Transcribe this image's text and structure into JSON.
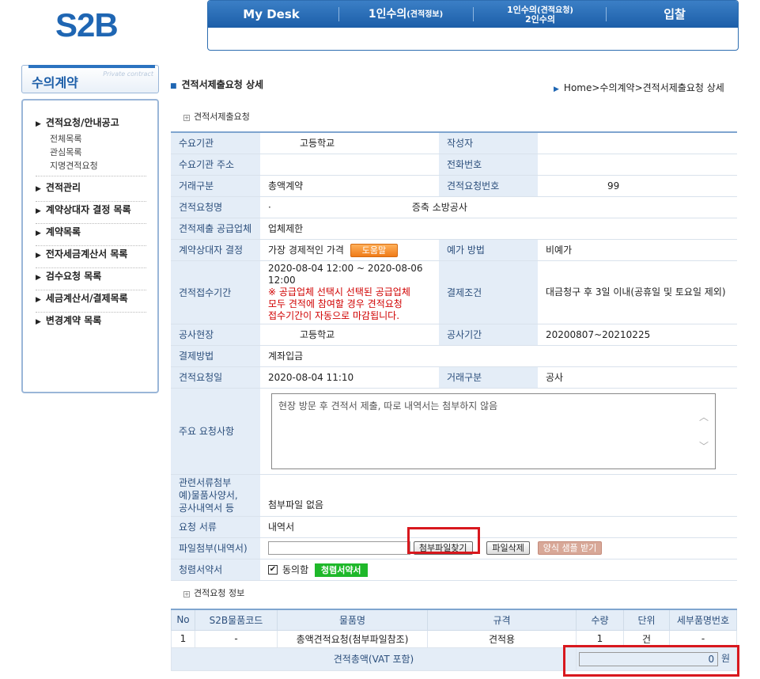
{
  "brand": {
    "logo": "S2B"
  },
  "topnav": {
    "mydesk": "My Desk",
    "single_main": "1인수의",
    "single_sub": "(견적정보)",
    "multi_line1_main": "1인수의",
    "multi_line1_sub": "(견적요청)",
    "multi_line2": "2인수의",
    "bid": "입찰"
  },
  "sidebar": {
    "title": "수의계약",
    "subtitle": "Private contract",
    "items": [
      {
        "label": "견적요청/안내공고",
        "subs": [
          "전체목록",
          "관심목록",
          "지명견적요청"
        ]
      },
      {
        "label": "견적관리"
      },
      {
        "label": "계약상대자 결정 목록"
      },
      {
        "label": "계약목록"
      },
      {
        "label": "전자세금계산서 목록"
      },
      {
        "label": "검수요청 목록"
      },
      {
        "label": "세금계산서/결제목록"
      },
      {
        "label": "변경계약 목록"
      }
    ]
  },
  "page": {
    "title": "견적서제출요청 상세",
    "breadcrumb": "Home>수의계약>견적서제출요청 상세",
    "section1": "견적서제출요청",
    "section2": "견적요청 정보"
  },
  "detail": {
    "buyer_label": "수요기관",
    "buyer_value": "고등학교",
    "author_label": "작성자",
    "author_value": "",
    "address_label": "수요기관 주소",
    "address_value": "",
    "phone_label": "전화번호",
    "phone_value": "",
    "trade_type_label": "거래구분",
    "trade_type_value": "총액계약",
    "req_no_label": "견적요청번호",
    "req_no_value": "99",
    "req_name_label": "견적요청명",
    "req_name_prefix": "·",
    "req_name_value": "증축 소방공사",
    "supplier_label": "견적제출 공급업체",
    "supplier_value": "업체제한",
    "decision_label": "계약상대자 결정",
    "decision_value": "가장 경제적인 가격",
    "help_button": "도움말",
    "price_method_label": "예가 방법",
    "price_method_value": "비예가",
    "period_label": "견적접수기간",
    "period_value": "2020-08-04 12:00 ~ 2020-08-06 12:00",
    "period_notice_1": "※ 공급업체 선택시 선택된 공급업체",
    "period_notice_2": "모두 견적에 참여할 경우 견적요청",
    "period_notice_3": "접수기간이 자동으로 마감됩니다.",
    "payment_cond_label": "결제조건",
    "payment_cond_value": "대금청구 후 3일 이내(공휴일 및 토요일 제외)",
    "site_label": "공사현장",
    "site_value": "고등학교",
    "work_period_label": "공사기간",
    "work_period_value": "20200807~20210225",
    "pay_method_label": "결제방법",
    "pay_method_value": "계좌입금",
    "req_date_label": "견적요청일",
    "req_date_value": "2020-08-04 11:10",
    "trade_type2_label": "거래구분",
    "trade_type2_value": "공사",
    "main_req_label": "주요 요청사항",
    "main_req_value": "현장 방문 후 견적서 제출, 따로 내역서는 첨부하지 않음",
    "attach_label_1": "관련서류첨부",
    "attach_label_2": "예)물품사양서,",
    "attach_label_3": "공사내역서 등",
    "attach_value": "첨부파일 없음",
    "req_docs_label": "요청 서류",
    "req_docs_value": "내역서",
    "file_label": "파일첨부(내역서)",
    "file_find": "첨부파일찾기",
    "file_delete": "파일삭제",
    "sample": "양식 샘플 받기",
    "pledge_label": "청렴서약서",
    "agree": "동의함",
    "pledge_button": "청렴서약서"
  },
  "items_table": {
    "headers": [
      "No",
      "S2B물품코드",
      "물품명",
      "규격",
      "수량",
      "단위",
      "세부품명번호"
    ],
    "rows": [
      [
        "1",
        "-",
        "총액견적요청(첨부파일참조)",
        "견적용",
        "1",
        "건",
        "-"
      ]
    ],
    "total_label": "견적총액(VAT 포함)",
    "total_value": "0",
    "currency": "원"
  }
}
